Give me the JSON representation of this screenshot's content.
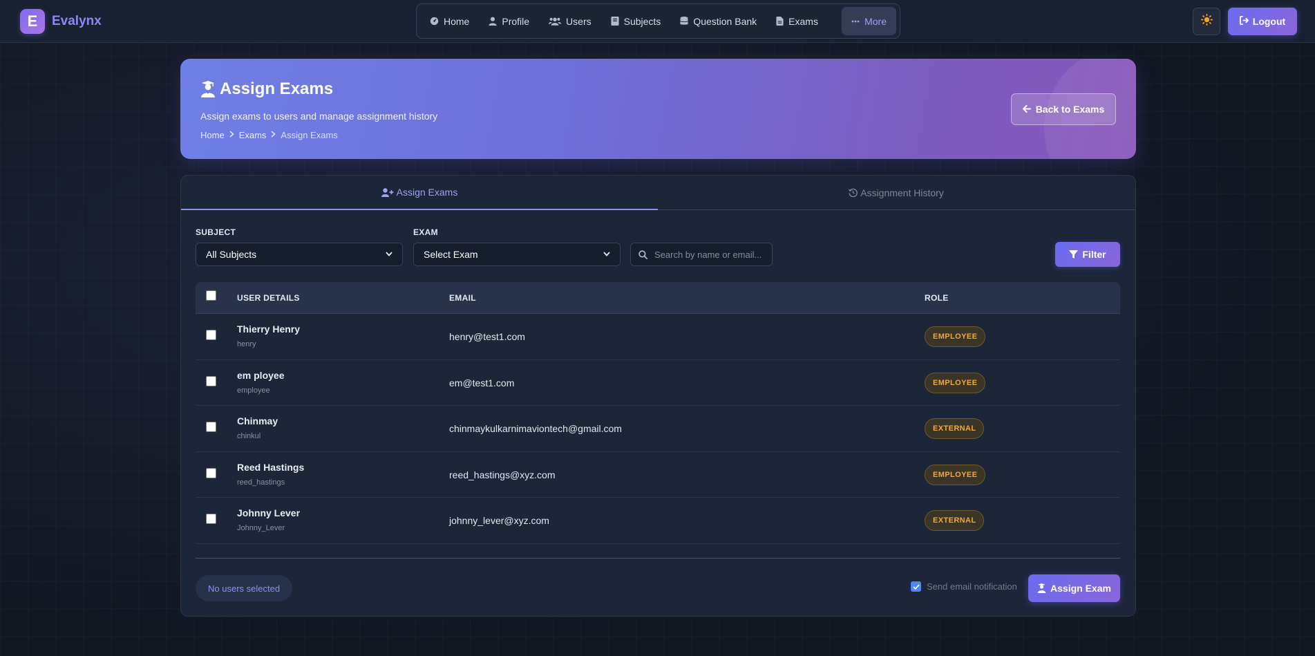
{
  "brand": {
    "logo_letter": "E",
    "name": "Evalynx"
  },
  "nav": {
    "items": [
      {
        "label": "Home",
        "icon": "dashboard-icon"
      },
      {
        "label": "Profile",
        "icon": "user-icon"
      },
      {
        "label": "Users",
        "icon": "users-icon"
      },
      {
        "label": "Subjects",
        "icon": "book-icon"
      },
      {
        "label": "Question Bank",
        "icon": "database-icon"
      },
      {
        "label": "Exams",
        "icon": "file-icon"
      },
      {
        "label": "More",
        "icon": "ellipsis-icon"
      }
    ],
    "active": "More",
    "theme_icon": "sun-icon",
    "logout_label": "Logout"
  },
  "hero": {
    "title": "Assign Exams",
    "subtitle": "Assign exams to users and manage assignment history",
    "breadcrumb": [
      "Home",
      "Exams",
      "Assign Exams"
    ],
    "back_label": "Back to Exams"
  },
  "tabs": [
    {
      "label": "Assign Exams",
      "icon": "user-plus-icon",
      "active": true
    },
    {
      "label": "Assignment History",
      "icon": "history-icon",
      "active": false
    }
  ],
  "filters": {
    "subject_label": "SUBJECT",
    "subject_value": "All Subjects",
    "exam_label": "EXAM",
    "exam_value": "Select Exam",
    "search_placeholder": "Search by name or email...",
    "filter_label": "Filter"
  },
  "table": {
    "headers": {
      "user": "USER DETAILS",
      "email": "EMAIL",
      "role": "ROLE"
    },
    "rows": [
      {
        "name": "Thierry Henry",
        "username": "henry",
        "email": "henry@test1.com",
        "role": "EMPLOYEE"
      },
      {
        "name": "em ployee",
        "username": "employee",
        "email": "em@test1.com",
        "role": "EMPLOYEE"
      },
      {
        "name": "Chinmay",
        "username": "chinkul",
        "email": "chinmaykulkarnimaviontech@gmail.com",
        "role": "EXTERNAL"
      },
      {
        "name": "Reed Hastings",
        "username": "reed_hastings",
        "email": "reed_hastings@xyz.com",
        "role": "EMPLOYEE"
      },
      {
        "name": "Johnny Lever",
        "username": "Johnny_Lever",
        "email": "johnny_lever@xyz.com",
        "role": "EXTERNAL"
      }
    ]
  },
  "footer": {
    "selection_status": "No users selected",
    "notify_label": "Send email notification",
    "notify_checked": true,
    "assign_label": "Assign Exam"
  },
  "colors": {
    "accent": "#6a6cf0",
    "badge_text": "#f0a93a",
    "background": "#141927"
  }
}
